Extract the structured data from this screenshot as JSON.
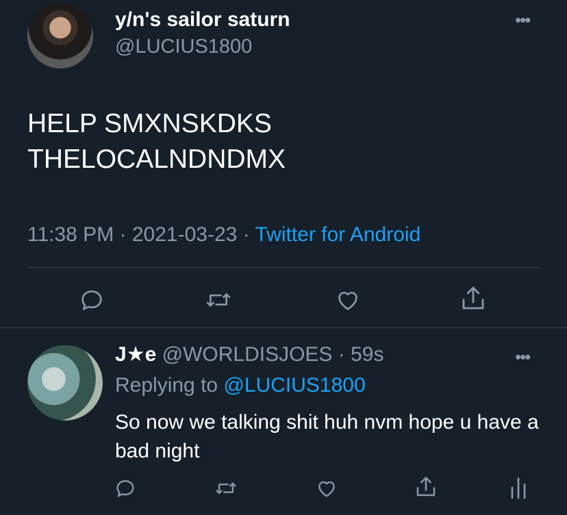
{
  "main_tweet": {
    "display_name": "y/n's sailor saturn",
    "handle": "@LUCIUS1800",
    "more": "•••",
    "text_line1": "HELP SMXNSKDKS",
    "text_line2": "THELOCALNDNDMX",
    "time": "11:38 PM",
    "sep1": "·",
    "date": "2021-03-23",
    "sep2": "·",
    "source": "Twitter for Android"
  },
  "reply_tweet": {
    "display_name": "J★e",
    "handle": "@WORLDISJOES",
    "sep": "·",
    "age": "59s",
    "more": "•••",
    "replying_prefix": "Replying to",
    "replying_handle": "@LUCIUS1800",
    "text": "So now we talking shit huh nvm hope u have a bad night"
  },
  "icons": {
    "reply": "reply-icon",
    "retweet": "retweet-icon",
    "like": "heart-icon",
    "share": "share-icon",
    "analytics": "analytics-icon"
  },
  "colors": {
    "background": "#15202b",
    "text": "#ffffff",
    "secondary": "#8899a6",
    "accent": "#1da1f2",
    "divider": "#38444d"
  }
}
